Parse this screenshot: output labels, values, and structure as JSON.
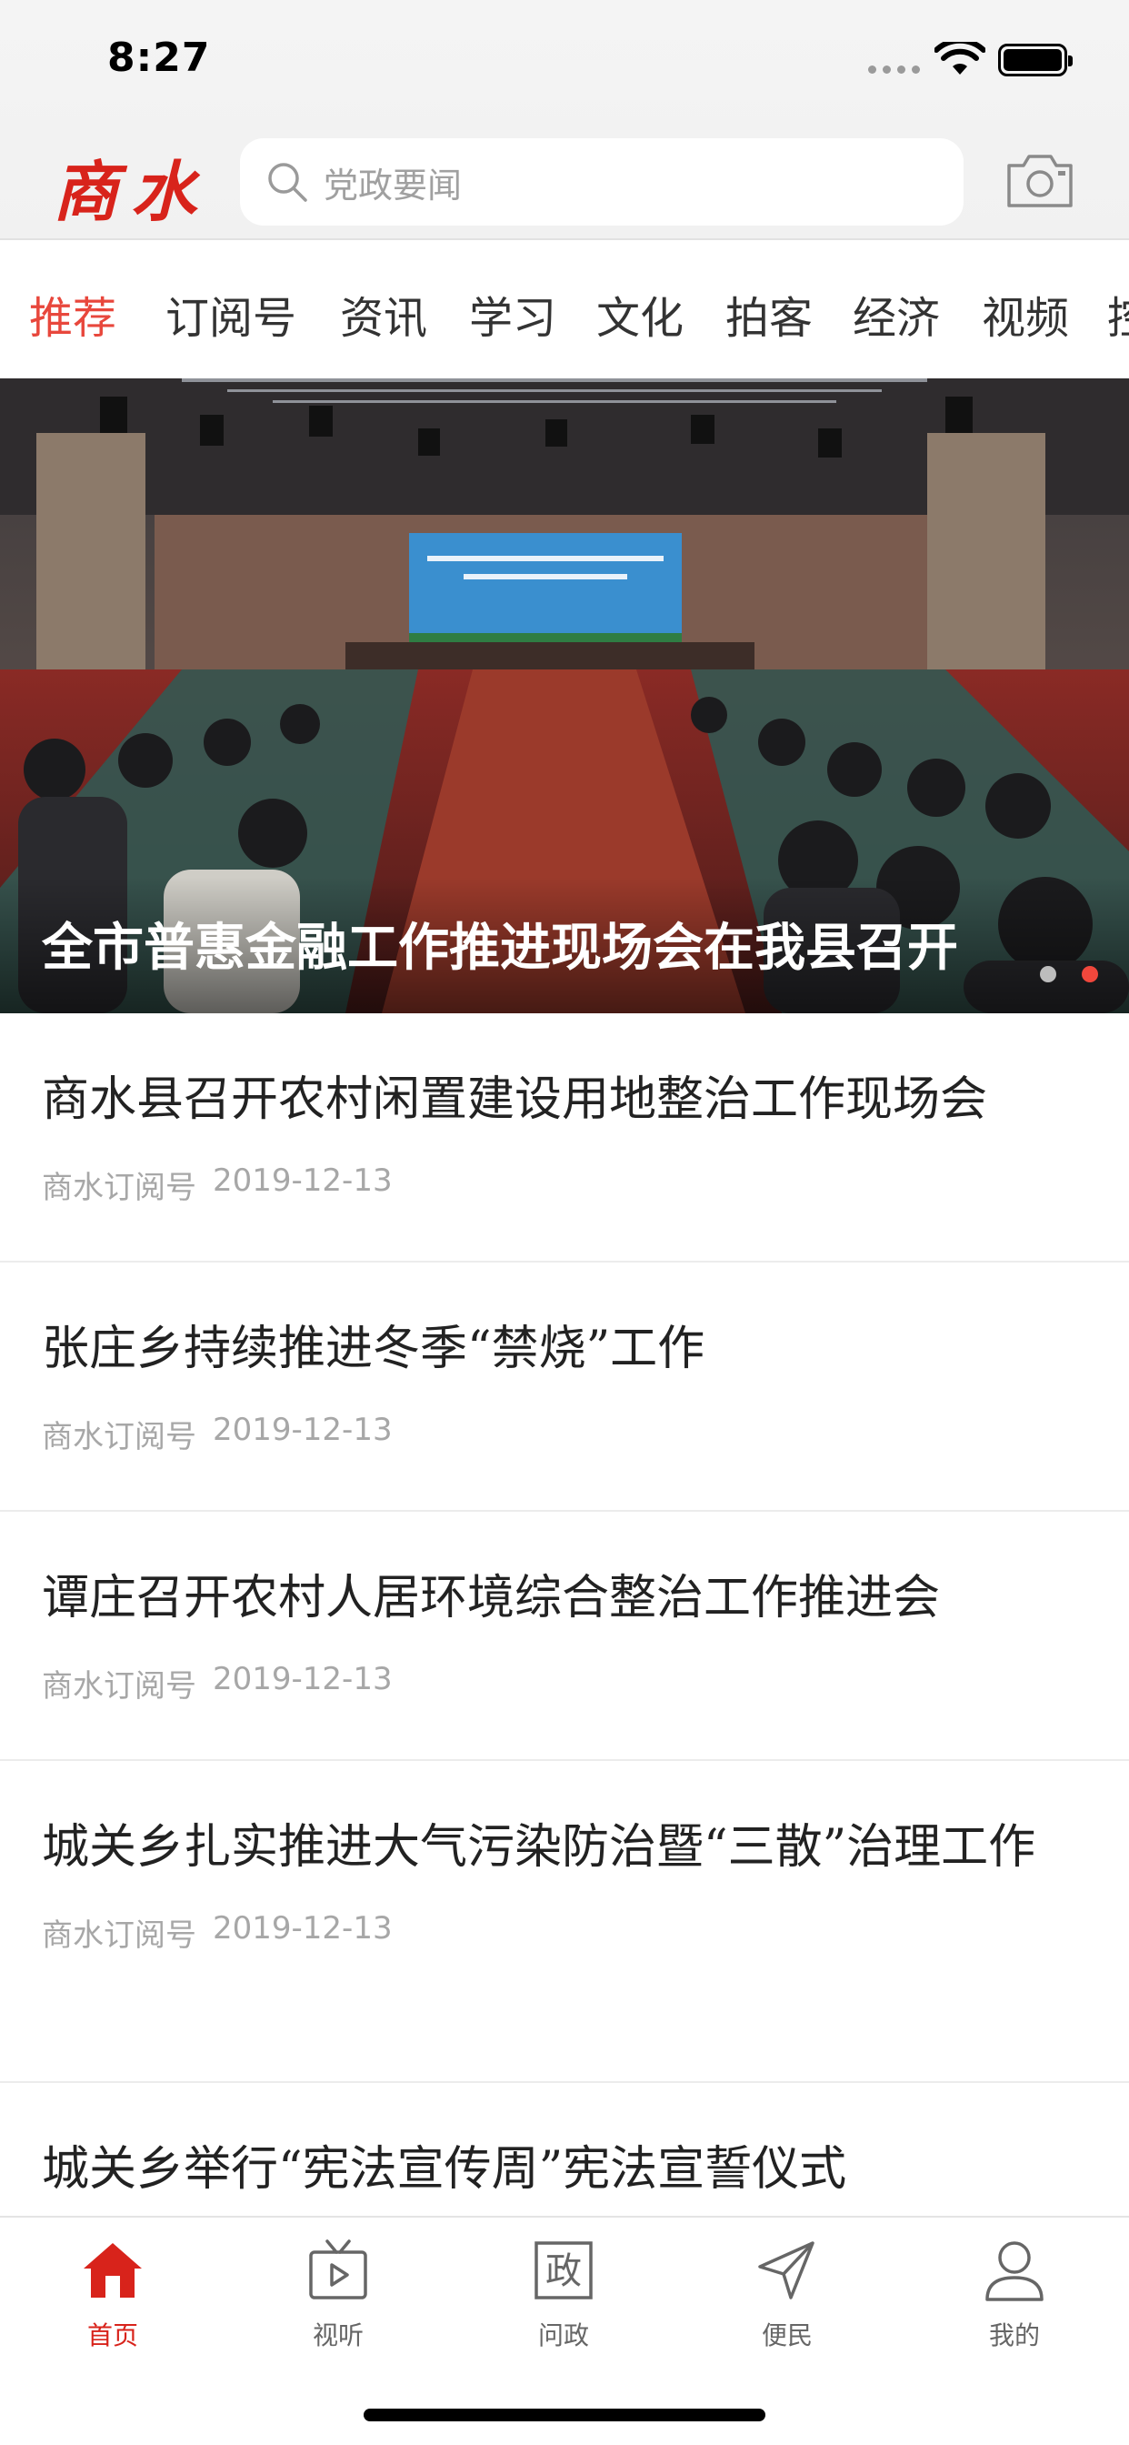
{
  "status_bar": {
    "time": "8:27"
  },
  "header": {
    "logo_text": "商水",
    "search": {
      "placeholder": "党政要闻"
    },
    "icons": {
      "search": "search-icon",
      "camera": "camera-icon"
    }
  },
  "tabs": [
    {
      "label": "推荐",
      "active": true
    },
    {
      "label": "订阅号"
    },
    {
      "label": "资讯"
    },
    {
      "label": "学习"
    },
    {
      "label": "文化"
    },
    {
      "label": "拍客"
    },
    {
      "label": "经济"
    },
    {
      "label": "视频"
    },
    {
      "label": "控"
    }
  ],
  "hero": {
    "title": "全市普惠金融工作推进现场会在我县召开",
    "slide_count": 2,
    "active_slide": 2
  },
  "news": [
    {
      "title": "商水县召开农村闲置建设用地整治工作现场会",
      "source": "商水订阅号",
      "date": "2019-12-13"
    },
    {
      "title": "张庄乡持续推进冬季“禁烧”工作",
      "source": "商水订阅号",
      "date": "2019-12-13"
    },
    {
      "title": "谭庄召开农村人居环境综合整治工作推进会",
      "source": "商水订阅号",
      "date": "2019-12-13"
    },
    {
      "title": "城关乡扎实推进大气污染防治暨“三散”治理工作",
      "source": "商水订阅号",
      "date": "2019-12-13"
    },
    {
      "title": "城关乡举行“宪法宣传周”宪法宣誓仪式",
      "source": "",
      "date": ""
    }
  ],
  "bottom_nav": [
    {
      "label": "首页",
      "icon": "home-icon",
      "active": true
    },
    {
      "label": "视听",
      "icon": "tv-icon"
    },
    {
      "label": "问政",
      "icon": "zheng-icon",
      "glyph": "政"
    },
    {
      "label": "便民",
      "icon": "send-icon"
    },
    {
      "label": "我的",
      "icon": "user-icon"
    }
  ],
  "colors": {
    "accent": "#e8473c",
    "brand_red": "#d8231b"
  }
}
